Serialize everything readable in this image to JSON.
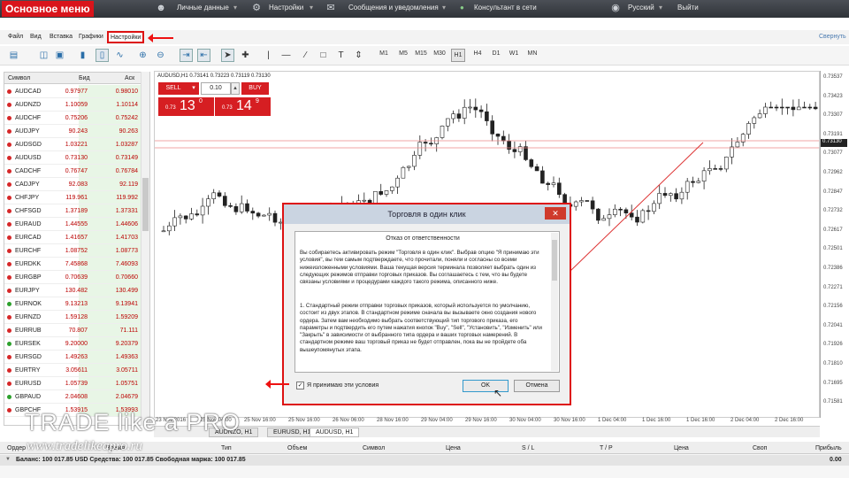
{
  "topbar": {
    "brand": "Основное меню",
    "personal": "Личные данные",
    "settings": "Настройки",
    "messages": "Сообщения и уведомления",
    "consultant": "Консультант в сети",
    "language": "Русский",
    "exit": "Выйти"
  },
  "menu": {
    "file": "Файл",
    "view": "Вид",
    "insert": "Вставка",
    "charts": "Графики",
    "settings": "Настройки",
    "collapse": "Свернуть"
  },
  "timeframes": [
    "M1",
    "M5",
    "M15",
    "M30",
    "H1",
    "H4",
    "D1",
    "W1",
    "MN"
  ],
  "symbols": {
    "headers": {
      "symbol": "Символ",
      "bid": "Бид",
      "ask": "Аск"
    },
    "rows": [
      [
        "AUDCAD",
        "0.97977",
        "0.98010",
        "red"
      ],
      [
        "AUDNZD",
        "1.10059",
        "1.10114",
        "red"
      ],
      [
        "AUDCHF",
        "0.75206",
        "0.75242",
        "red"
      ],
      [
        "AUDJPY",
        "90.243",
        "90.263",
        "red"
      ],
      [
        "AUDSGD",
        "1.03221",
        "1.03287",
        "red"
      ],
      [
        "AUDUSD",
        "0.73130",
        "0.73149",
        "red"
      ],
      [
        "CADCHF",
        "0.76747",
        "0.76784",
        "red"
      ],
      [
        "CADJPY",
        "92.083",
        "92.119",
        "red"
      ],
      [
        "CHFJPY",
        "119.961",
        "119.992",
        "red"
      ],
      [
        "CHFSGD",
        "1.37189",
        "1.37331",
        "red"
      ],
      [
        "EURAUD",
        "1.44555",
        "1.44606",
        "red"
      ],
      [
        "EURCAD",
        "1.41657",
        "1.41703",
        "red"
      ],
      [
        "EURCHF",
        "1.08752",
        "1.08773",
        "red"
      ],
      [
        "EURDKK",
        "7.45868",
        "7.46093",
        "red"
      ],
      [
        "EURGBP",
        "0.70639",
        "0.70660",
        "red"
      ],
      [
        "EURJPY",
        "130.482",
        "130.499",
        "red"
      ],
      [
        "EURNOK",
        "9.13213",
        "9.13941",
        "green"
      ],
      [
        "EURNZD",
        "1.59128",
        "1.59209",
        "red"
      ],
      [
        "EURRUB",
        "70.807",
        "71.111",
        "red"
      ],
      [
        "EURSEK",
        "9.20000",
        "9.20379",
        "green"
      ],
      [
        "EURSGD",
        "1.49263",
        "1.49363",
        "red"
      ],
      [
        "EURTRY",
        "3.05611",
        "3.05711",
        "red"
      ],
      [
        "EURUSD",
        "1.05739",
        "1.05751",
        "red"
      ],
      [
        "GBPAUD",
        "2.04608",
        "2.04679",
        "green"
      ],
      [
        "GBPCHF",
        "1.53915",
        "1.53993",
        "red"
      ]
    ]
  },
  "chart": {
    "info": "AUDUSD,H1  0.73141 0.73223 0.73119 0.73130",
    "price_tag": "0.73130",
    "yticks": [
      "0.73537",
      "0.73423",
      "0.73307",
      "0.73191",
      "0.73077",
      "0.72962",
      "0.72847",
      "0.72732",
      "0.72617",
      "0.72501",
      "0.72386",
      "0.72271",
      "0.72156",
      "0.72041",
      "0.71926",
      "0.71810",
      "0.71695",
      "0.71581"
    ],
    "xticks": [
      "23 Nov 2016",
      "25 Nov 04:00",
      "25 Nov 16:00",
      "25 Nov 16:00",
      "26 Nov 06:00",
      "28 Nov 16:00",
      "29 Nov 04:00",
      "29 Nov 16:00",
      "30 Nov 04:00",
      "30 Nov 16:00",
      "1 Dec 04:00",
      "1 Dec 16:00",
      "1 Dec 16:00",
      "2 Dec 04:00",
      "2 Dec 16:00"
    ],
    "tabs": [
      "AUDNZO, H1",
      "EURUSD, H1",
      "AUDUSD, H1"
    ]
  },
  "oct": {
    "sell": "SELL",
    "buy": "BUY",
    "lot": "0.10",
    "sell_prefix": "0.73",
    "sell_big": "13",
    "sell_sup": "0",
    "buy_prefix": "0.73",
    "buy_big": "14",
    "buy_sup": "9"
  },
  "modal": {
    "title": "Торговля в один клик",
    "heading": "Отказ от ответственности",
    "para1": "Вы собираетесь активировать режим \"Торговля в один клик\". Выбрав опцию \"Я принимаю эти условия\", вы тем самым подтверждаете, что прочитали, поняли и согласны со всеми нижеизложенными условиями. Ваша текущая версия терминала позволяет выбрать один из следующих режимов отправки торговых приказов. Вы соглашаетесь с тем, что вы будете связаны условиями и процедурами каждого такого режима, описанного ниже.",
    "para2": "1. Стандартный режим отправки торговых приказов, который используется по умолчанию, состоит из двух этапов. В стандартном режиме сначала вы вызываете окно создания нового ордера. Затем вам необходимо выбрать соответствующий тип торгового приказа, его параметры и подтвердить его путем нажатия кнопок \"Buy\", \"Sell\", \"Установить\", \"Изменить\" или \"Закрыть\" в зависимости от выбранного типа ордера и ваших торговых намерений. В стандартном режиме ваш торговый приказ не будет отправлен, пока вы не пройдете оба вышеупомянутых этапа.",
    "accept": "Я принимаю эти условия",
    "ok": "OK",
    "cancel": "Отмена"
  },
  "orders": {
    "headers": [
      "Ордер",
      "Время",
      "Тип",
      "Объем",
      "Символ",
      "Цена",
      "S / L",
      "T / P",
      "Цена",
      "Своп",
      "Прибыль"
    ],
    "balance": "Баланс: 100 017.85 USD  Средства: 100 017.85  Свободная маржа: 100 017.85",
    "profit": "0.00"
  },
  "watermark": {
    "line1": "TRADE like a PRO",
    "line2": "www.tradelikeapro.ru"
  },
  "colors": {
    "brand": "#d9141b",
    "sell": "#d61e22",
    "highlight": "#dd1111"
  }
}
